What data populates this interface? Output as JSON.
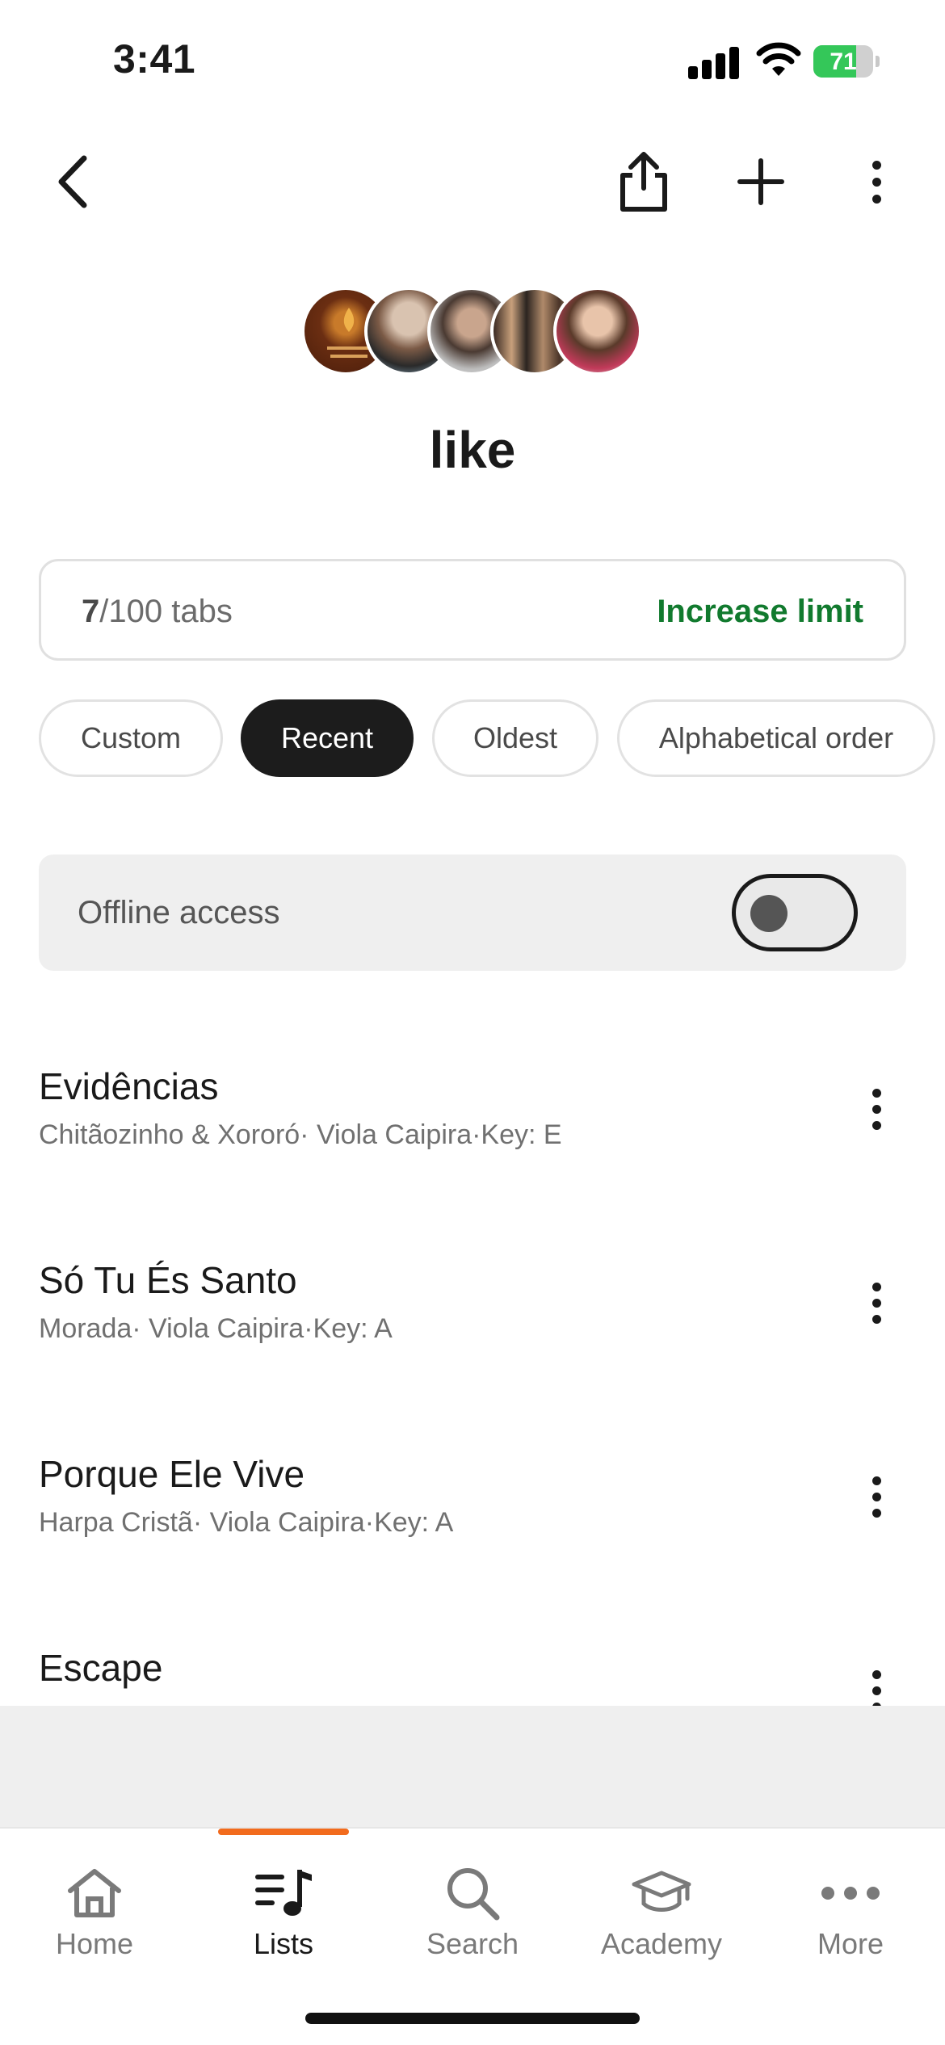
{
  "status_bar": {
    "time": "3:41",
    "battery_level": "71"
  },
  "nav": {
    "back_icon": "chevron-left-icon",
    "share_icon": "share-icon",
    "add_icon": "plus-icon",
    "menu_icon": "kebab-icon"
  },
  "list": {
    "title": "like"
  },
  "limit": {
    "count": "7",
    "total": "/100 tabs",
    "action": "Increase limit"
  },
  "sort_options": [
    {
      "label": "Custom",
      "active": false
    },
    {
      "label": "Recent",
      "active": true
    },
    {
      "label": "Oldest",
      "active": false
    },
    {
      "label": "Alphabetical order",
      "active": false
    }
  ],
  "offline": {
    "label": "Offline access",
    "enabled": false
  },
  "songs": [
    {
      "title": "Evidências",
      "meta": "Chitãozinho & Xororó· Viola Caipira·Key: E"
    },
    {
      "title": "Só Tu És Santo",
      "meta": "Morada· Viola Caipira·Key: A"
    },
    {
      "title": "Porque Ele Vive",
      "meta": "Harpa Cristã· Viola Caipira·Key: A"
    },
    {
      "title": "Escape",
      "meta": ""
    }
  ],
  "tabs": [
    {
      "label": "Home",
      "icon": "home-icon",
      "active": false
    },
    {
      "label": "Lists",
      "icon": "lists-icon",
      "active": true
    },
    {
      "label": "Search",
      "icon": "search-icon",
      "active": false
    },
    {
      "label": "Academy",
      "icon": "graduation-cap-icon",
      "active": false
    },
    {
      "label": "More",
      "icon": "more-icon",
      "active": false
    }
  ],
  "colors": {
    "accent_green": "#117a2e",
    "tab_indicator": "#f26b1d",
    "chip_active": "#1c1c1c"
  }
}
